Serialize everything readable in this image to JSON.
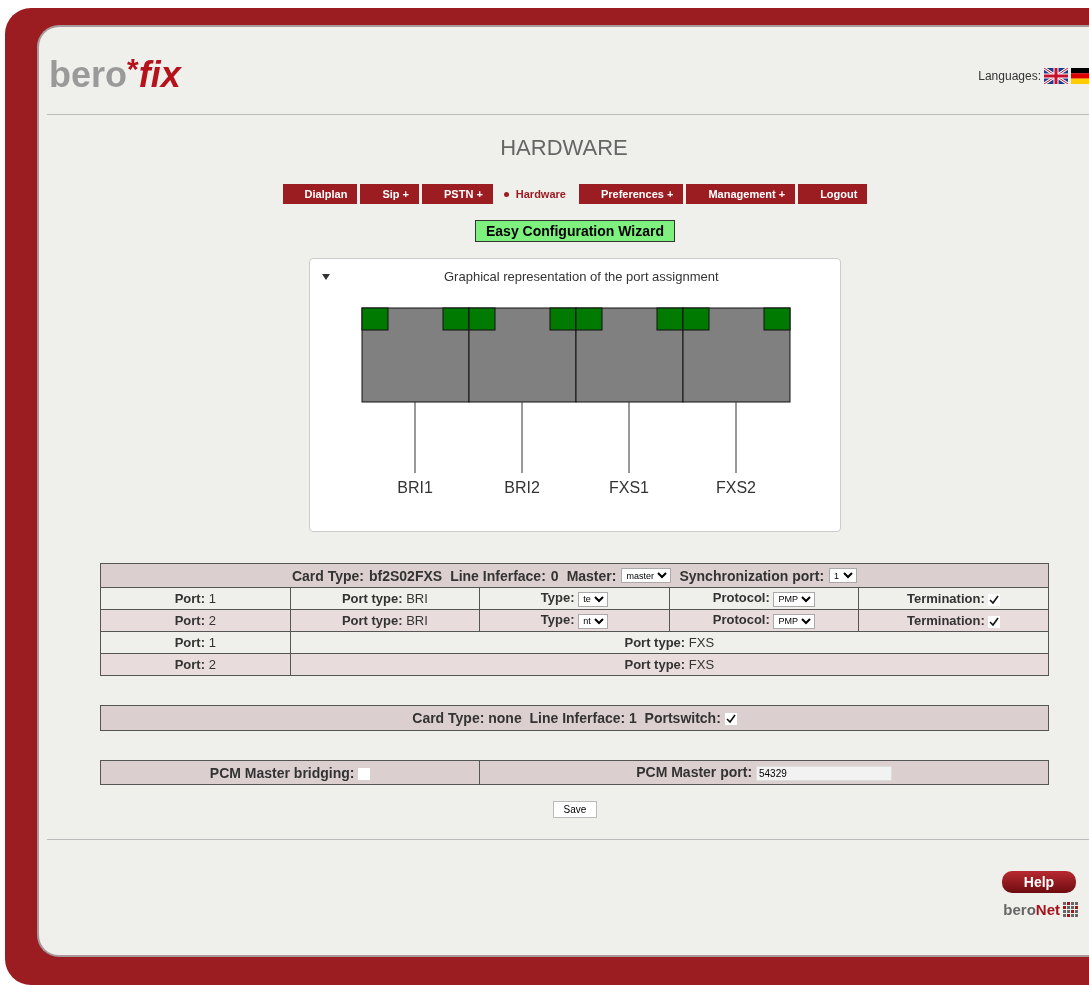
{
  "header": {
    "logo_left": "bero",
    "logo_star": "*",
    "logo_right": "fix",
    "languages_label": "Languages:"
  },
  "title": "HARDWARE",
  "nav": [
    {
      "label": "Dialplan",
      "selected": false
    },
    {
      "label": "Sip +",
      "selected": false
    },
    {
      "label": "PSTN +",
      "selected": false
    },
    {
      "label": "Hardware",
      "selected": true
    },
    {
      "label": "Preferences +",
      "selected": false
    },
    {
      "label": "Management +",
      "selected": false
    },
    {
      "label": "Logout",
      "selected": false
    }
  ],
  "wizard_button": "Easy Configuration Wizard",
  "port_diagram": {
    "title": "Graphical representation of the port assignment",
    "expanded": true,
    "ports": [
      "BRI1",
      "BRI2",
      "FXS1",
      "FXS2"
    ]
  },
  "card_0": {
    "header": [
      {
        "kind": "text",
        "label": "Card Type:",
        "value": "bf2S02FXS"
      },
      {
        "kind": "text",
        "label": "Line Inferface:",
        "value": "0"
      },
      {
        "kind": "select",
        "label": "Master:",
        "value": "master"
      },
      {
        "kind": "select",
        "label": "Synchronization port:",
        "value": "1"
      }
    ],
    "rows": [
      {
        "kind": "bri",
        "port_label": "Port:",
        "port": "1",
        "port_type_label": "Port type:",
        "port_type": "BRI",
        "type_label": "Type:",
        "type": "te",
        "protocol_label": "Protocol:",
        "protocol": "PMP",
        "termination_label": "Termination:",
        "termination": true
      },
      {
        "kind": "bri",
        "port_label": "Port:",
        "port": "2",
        "port_type_label": "Port type:",
        "port_type": "BRI",
        "type_label": "Type:",
        "type": "nt",
        "protocol_label": "Protocol:",
        "protocol": "PMP",
        "termination_label": "Termination:",
        "termination": true
      },
      {
        "kind": "fxs",
        "port_label": "Port:",
        "port": "1",
        "port_type_label": "Port type:",
        "port_type": "FXS"
      },
      {
        "kind": "fxs",
        "port_label": "Port:",
        "port": "2",
        "port_type_label": "Port type:",
        "port_type": "FXS"
      }
    ]
  },
  "card_1": {
    "header": "Card Type: none  Line Inferface: 1  Portswitch:",
    "portswitch": true
  },
  "pcm": {
    "bridging_label": "PCM Master bridging:",
    "bridging": false,
    "port_label": "PCM Master port:",
    "port": "54329"
  },
  "save_button": "Save",
  "help_button": "Help",
  "footer_logo": {
    "left": "bero",
    "right": "Net"
  }
}
